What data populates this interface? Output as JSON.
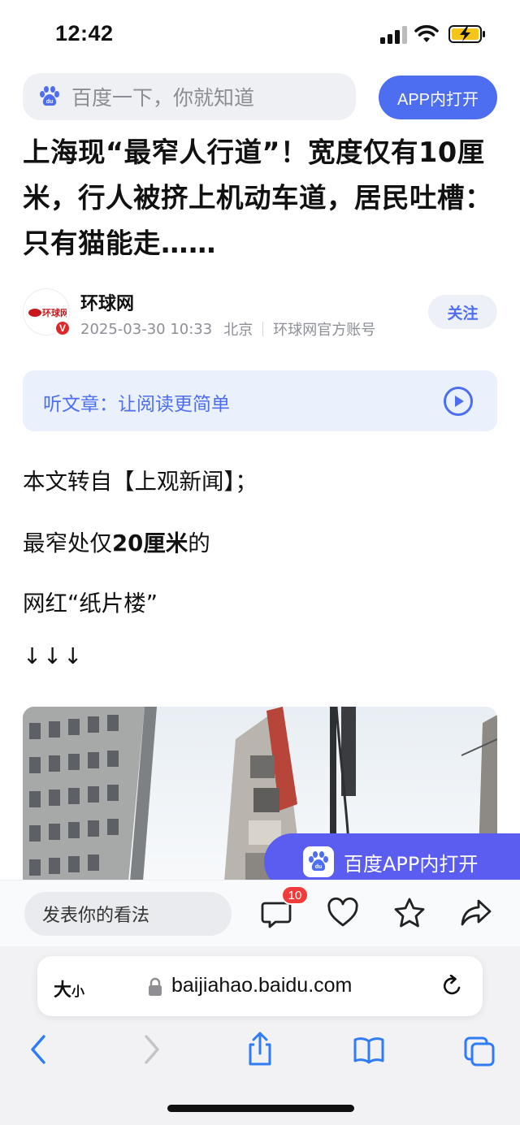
{
  "status_bar": {
    "time": "12:42"
  },
  "search": {
    "placeholder": "百度一下，你就知道",
    "app_button": "APP内打开"
  },
  "article": {
    "title": "上海现“最窄人行道”！宽度仅有10厘米，行人被挤上机动车道，居民吐槽：只有猫能走……",
    "author": {
      "name": "环球网",
      "avatar_text": "环球网",
      "verified_badge": "V",
      "datetime": "2025-03-30 10:33",
      "location": "北京",
      "account_type": "环球网官方账号",
      "follow_label": "关注"
    },
    "listen": {
      "label": "听文章：让阅读更简单"
    },
    "paragraphs": {
      "p1": "本文转自【上观新闻】；",
      "p2_prefix": "最窄处仅",
      "p2_bold": "20厘米",
      "p2_suffix": "的",
      "p3": "网红“纸片楼”",
      "p4": "↓↓↓"
    }
  },
  "floating_app_button": {
    "label": "百度APP内打开"
  },
  "comment_bar": {
    "input_placeholder": "发表你的看法",
    "comment_count": "10"
  },
  "browser": {
    "text_size_big": "大",
    "text_size_small": "小",
    "url": "baijiahao.baidu.com"
  },
  "colors": {
    "accent": "#4e6ef2",
    "float_button": "#5b5cf0",
    "badge_red": "#f23b3b",
    "listen_bg": "#eaf1fd"
  }
}
